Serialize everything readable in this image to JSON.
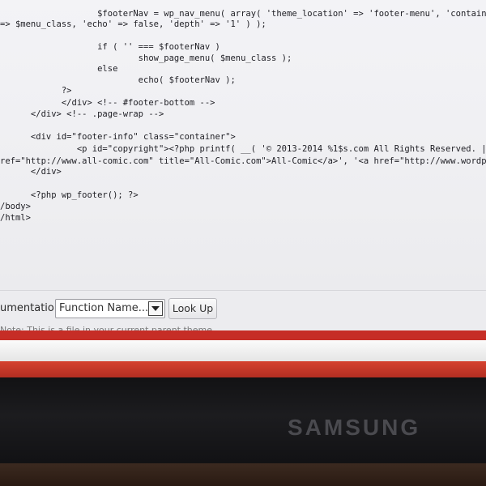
{
  "code_lines": [
    "                   $footerNav = wp_nav_menu( array( 'theme_location' => 'footer-menu', 'container' =>",
    "=> $menu_class, 'echo' => false, 'depth' => '1' ) );",
    "",
    "                   if ( '' === $footerNav )",
    "                           show_page_menu( $menu_class );",
    "                   else",
    "                           echo( $footerNav );",
    "            ?>",
    "            </div> <!-- #footer-bottom -->",
    "      </div> <!-- .page-wrap -->",
    "",
    "      <div id=\"footer-info\" class=\"container\">",
    "               <p id=\"copyright\"><?php printf( __( '© 2013-2014 %1$s.com All Rights Reserved. | Powered",
    "ref=\"http://www.all-comic.com\" title=\"All-Comic.com\">All-Comic</a>', '<a href=\"http://www.wordpress.org\"",
    "      </div>",
    "",
    "      <?php wp_footer(); ?>",
    "/body>",
    "/html>"
  ],
  "documentation": {
    "label": "umentation:",
    "select_value": "Function Name...",
    "lookup_label": "Look Up"
  },
  "notice_text": "Note: This is a file in your current parent theme.",
  "monitor_brand": "SAMSUNG",
  "colors": {
    "accent_red": "#c62d26",
    "screen_bg": "#f3f3f6"
  }
}
